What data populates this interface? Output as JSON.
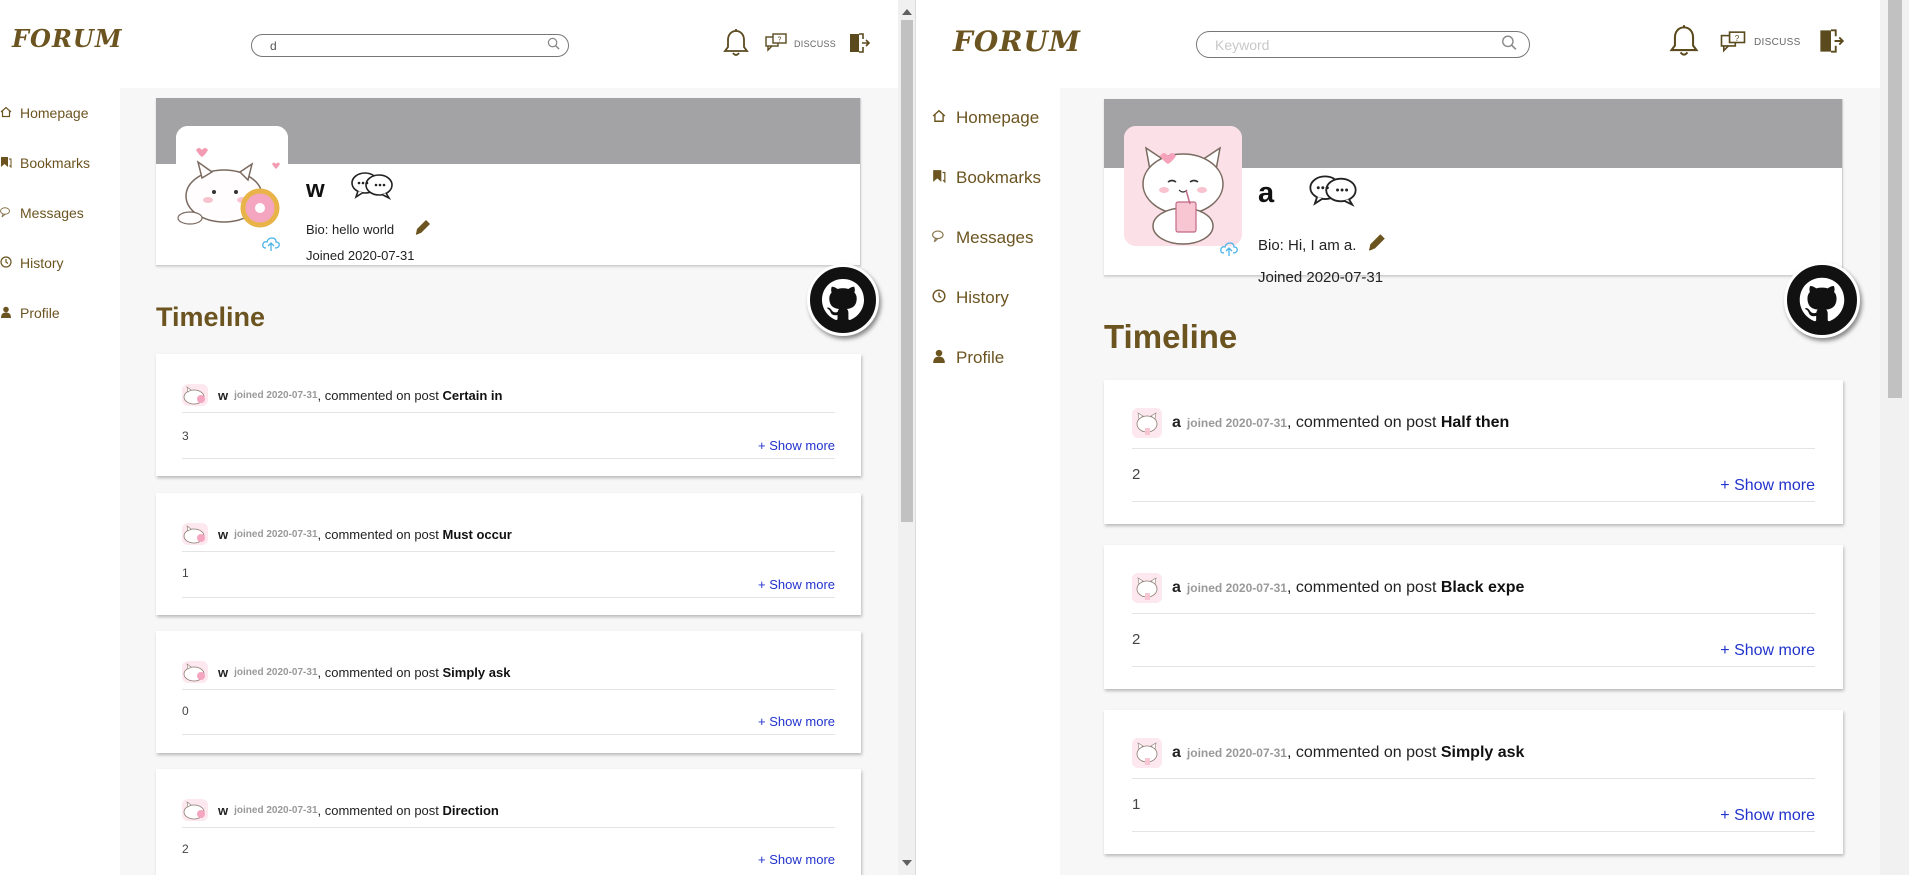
{
  "left": {
    "logo": "FORUM",
    "search": {
      "value": "d",
      "placeholder": "Keyword"
    },
    "discuss_label": "DISCUSS",
    "nav": [
      {
        "label": "Homepage",
        "icon": "home-icon"
      },
      {
        "label": "Bookmarks",
        "icon": "bookmark-icon"
      },
      {
        "label": "Messages",
        "icon": "chat-icon"
      },
      {
        "label": "History",
        "icon": "clock-icon"
      },
      {
        "label": "Profile",
        "icon": "user-icon"
      }
    ],
    "profile": {
      "username": "w",
      "bio": "Bio: hello world",
      "joined": "Joined 2020-07-31"
    },
    "timeline_title": "Timeline",
    "entries": [
      {
        "author": "w",
        "joined": "joined 2020-07-31",
        "action": ", commented on post ",
        "post": "Certain in",
        "content": "3",
        "more": "+ Show more"
      },
      {
        "author": "w",
        "joined": "joined 2020-07-31",
        "action": ", commented on post ",
        "post": "Must occur",
        "content": "1",
        "more": "+ Show more"
      },
      {
        "author": "w",
        "joined": "joined 2020-07-31",
        "action": ", commented on post ",
        "post": "Simply ask",
        "content": "0",
        "more": "+ Show more"
      },
      {
        "author": "w",
        "joined": "joined 2020-07-31",
        "action": ", commented on post ",
        "post": "Direction",
        "content": "2",
        "more": "+ Show more"
      }
    ]
  },
  "right": {
    "logo": "FORUM",
    "search": {
      "value": "",
      "placeholder": "Keyword"
    },
    "discuss_label": "DISCUSS",
    "nav": [
      {
        "label": "Homepage",
        "icon": "home-icon"
      },
      {
        "label": "Bookmarks",
        "icon": "bookmark-icon"
      },
      {
        "label": "Messages",
        "icon": "chat-icon"
      },
      {
        "label": "History",
        "icon": "clock-icon"
      },
      {
        "label": "Profile",
        "icon": "user-icon"
      }
    ],
    "profile": {
      "username": "a",
      "bio": "Bio: Hi, I am a.",
      "joined": "Joined 2020-07-31"
    },
    "timeline_title": "Timeline",
    "entries": [
      {
        "author": "a",
        "joined": "joined 2020-07-31",
        "action": ", commented on post ",
        "post": "Half then",
        "content": "2",
        "more": "+ Show more"
      },
      {
        "author": "a",
        "joined": "joined 2020-07-31",
        "action": ", commented on post ",
        "post": "Black expe",
        "content": "2",
        "more": "+ Show more"
      },
      {
        "author": "a",
        "joined": "joined 2020-07-31",
        "action": ", commented on post ",
        "post": "Simply ask",
        "content": "1",
        "more": "+ Show more"
      }
    ]
  },
  "colors": {
    "accent": "#6b5420",
    "banner": "#a3a3a5",
    "link": "#2233cc"
  }
}
